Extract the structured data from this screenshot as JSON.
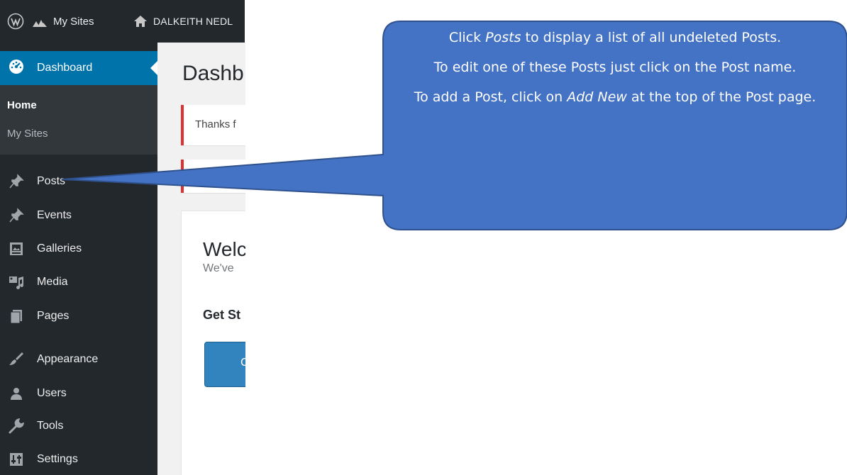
{
  "adminbar": {
    "wp_logo_icon": "wordpress-logo-icon",
    "my_sites_icon": "network-icon",
    "my_sites_label": "My Sites",
    "site_icon": "home-icon",
    "site_name": "DALKEITH NEDL"
  },
  "sidebar": {
    "dashboard": {
      "label": "Dashboard",
      "icon": "dashboard-icon"
    },
    "submenu": {
      "home": "Home",
      "my_sites": "My Sites"
    },
    "items": [
      {
        "label": "Posts",
        "icon": "pin-icon"
      },
      {
        "label": "Events",
        "icon": "pin-icon"
      },
      {
        "label": "Galleries",
        "icon": "gallery-icon"
      },
      {
        "label": "Media",
        "icon": "media-icon"
      },
      {
        "label": "Pages",
        "icon": "pages-icon"
      },
      {
        "label": "Appearance",
        "icon": "brush-icon"
      },
      {
        "label": "Users",
        "icon": "users-icon"
      },
      {
        "label": "Tools",
        "icon": "wrench-icon"
      },
      {
        "label": "Settings",
        "icon": "settings-icon"
      }
    ],
    "colors": {
      "background": "#23282d",
      "active": "#0073aa",
      "submenu": "#32373c"
    }
  },
  "content": {
    "page_title": "Dashb",
    "notice_text": "Thanks f",
    "welcome_title": "Welc",
    "welcome_subtitle": "We've",
    "get_started": "Get St",
    "customize_button": "C"
  },
  "callout": {
    "line1_prefix": "Click ",
    "line1_em": "Posts",
    "line1_suffix": " to display a list of all undeleted Posts.",
    "line2": "To edit one of these Posts just click on the Post name.",
    "line3_prefix": "To add a Post, click on ",
    "line3_em": "Add New",
    "line3_suffix": " at the top of the Post page.",
    "colors": {
      "fill": "#4472c4",
      "stroke": "#2f528f"
    }
  }
}
